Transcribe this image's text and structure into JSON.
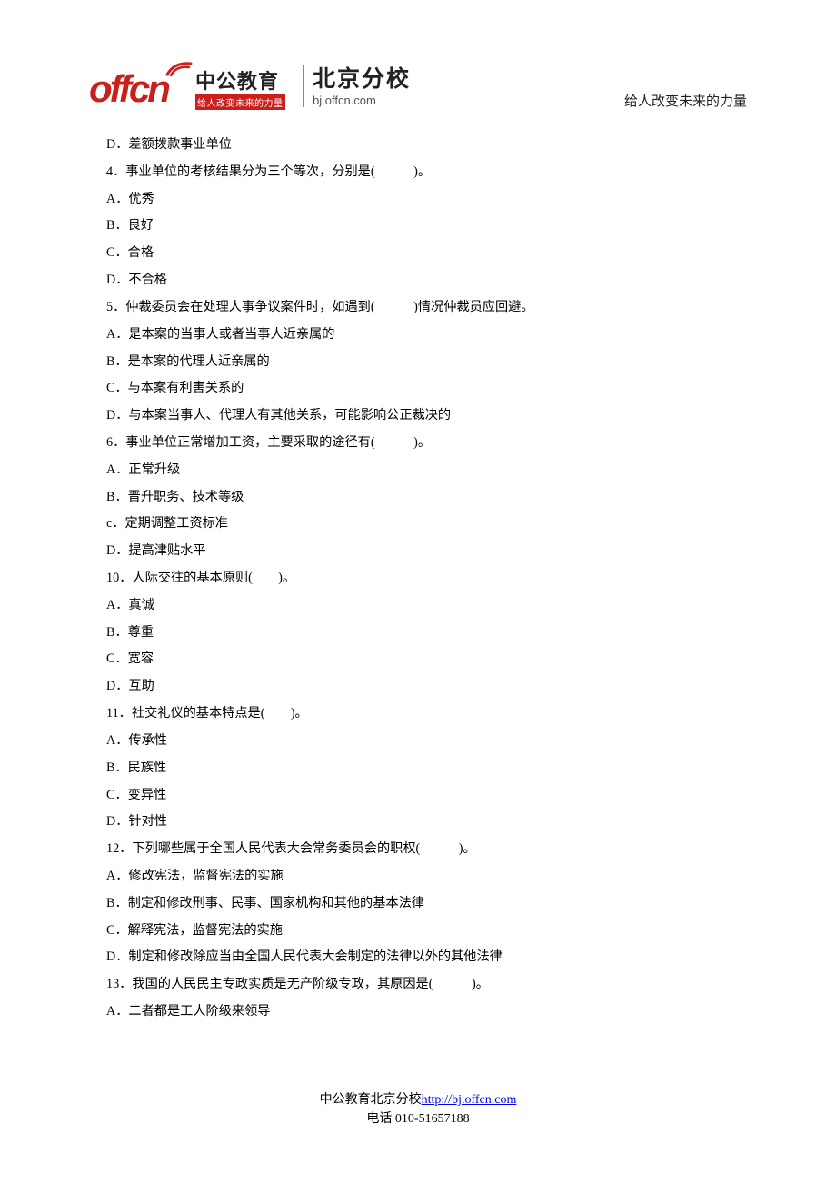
{
  "header": {
    "logo_text": "offcn",
    "brand_cn": "中公教育",
    "brand_sub": "给人改变未来的力量",
    "branch": "北京分校",
    "branch_url": "bj.offcn.com",
    "slogan_right": "给人改变未来的力量"
  },
  "body": {
    "lines": [
      "D．差额拨款事业单位",
      "4．事业单位的考核结果分为三个等次，分别是(　　　)。",
      "A．优秀",
      "B．良好",
      "C．合格",
      "D．不合格",
      "5．仲裁委员会在处理人事争议案件时，如遇到(　　　)情况仲裁员应回避。",
      "A．是本案的当事人或者当事人近亲属的",
      "B．是本案的代理人近亲属的",
      "C．与本案有利害关系的",
      "D．与本案当事人、代理人有其他关系，可能影响公正裁决的",
      "6．事业单位正常增加工资，主要采取的途径有(　　　)。",
      "A．正常升级",
      "B．晋升职务、技术等级",
      "c．定期调整工资标准",
      "D．提高津贴水平",
      "10．人际交往的基本原则(　　)。",
      "A．真诚",
      "B．尊重",
      "C．宽容",
      "D．互助",
      "11．社交礼仪的基本特点是(　　)。",
      "A．传承性",
      "B．民族性",
      "C．变异性",
      "D．针对性",
      "12．下列哪些属于全国人民代表大会常务委员会的职权(　　　)。",
      "A．修改宪法，监督宪法的实施",
      "B．制定和修改刑事、民事、国家机构和其他的基本法律",
      "C．解释宪法，监督宪法的实施",
      "D．制定和修改除应当由全国人民代表大会制定的法律以外的其他法律",
      "13．我国的人民民主专政实质是无产阶级专政，其原因是(　　　)。",
      "A．二者都是工人阶级来领导"
    ]
  },
  "footer": {
    "line1_prefix": "中公教育北京分校",
    "line1_link": "http://bj.offcn.com",
    "line2": "电话 010-51657188"
  }
}
